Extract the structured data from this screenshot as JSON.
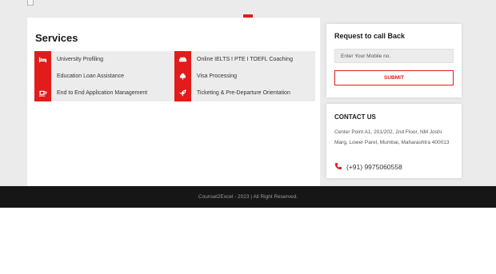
{
  "services": {
    "title": "Services",
    "items": [
      {
        "label": "University Profiling",
        "icon": "bed-icon"
      },
      {
        "label": "Online IELTS I PTE I TOEFL Coaching",
        "icon": "sofa-icon"
      },
      {
        "label": "Education Loan Assistance",
        "icon": "money-icon"
      },
      {
        "label": "Visa Processing",
        "icon": "tree-icon"
      },
      {
        "label": "End to End Application Management",
        "icon": "coffee-icon"
      },
      {
        "label": "Ticketing & Pre-Departure Orientation",
        "icon": "rocket-icon"
      }
    ]
  },
  "callback": {
    "title": "Request to call Back",
    "mobile_placeholder": "Enter Your Mobile no.",
    "submit_label": "SUBMIT"
  },
  "contact": {
    "title": "CONTACT US",
    "address": "Center Point A1, 201/202, 2nd Floor, NM Joshi Marg, Lower Parel, Mumbai, Maharashtra 400013",
    "phone": "(+91) 9975060558"
  },
  "footer": {
    "text": "Counsel2Excel - 2023 | All Right Reserved."
  },
  "colors": {
    "accent": "#e21b1b",
    "footer_bg": "#161616",
    "page_bg": "#ebebeb"
  }
}
